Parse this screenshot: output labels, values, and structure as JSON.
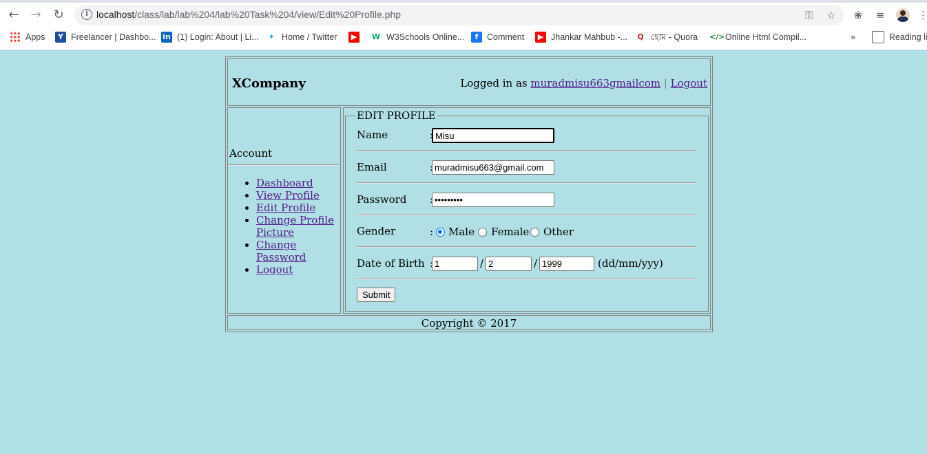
{
  "browser": {
    "url_host": "localhost",
    "url_path": "/class/lab/lab%204/lab%20Task%204/view/Edit%20Profile.php",
    "bookmarks": [
      {
        "label": "Apps",
        "icon": "apps-icon"
      },
      {
        "label": "Freelancer | Dashbo...",
        "icon": "freelancer-icon"
      },
      {
        "label": "(1) Login: About | Li...",
        "icon": "linkedin-icon"
      },
      {
        "label": "Home / Twitter",
        "icon": "twitter-icon"
      },
      {
        "label": "",
        "icon": "youtube-icon"
      },
      {
        "label": "W3Schools Online...",
        "icon": "w3schools-icon"
      },
      {
        "label": "Comment",
        "icon": "facebook-icon"
      },
      {
        "label": "Jhankar Mahbub -...",
        "icon": "youtube-icon"
      },
      {
        "label": "হোম - Quora",
        "icon": "quora-icon"
      },
      {
        "label": "Online Html Compil...",
        "icon": "code-icon"
      },
      {
        "label": "»",
        "icon": "more-bookmarks-icon"
      },
      {
        "label": "Reading lis",
        "icon": "reading-list-icon"
      }
    ]
  },
  "header": {
    "brand": "XCompany",
    "logged_in_prefix": "Logged in as",
    "user_link": "muradmisu663gmailcom",
    "separator": "|",
    "logout": "Logout"
  },
  "sidebar": {
    "title": "Account",
    "items": [
      "Dashboard",
      "View Profile",
      "Edit Profile",
      "Change Profile Picture",
      "Change Password",
      "Logout"
    ]
  },
  "form": {
    "legend": "EDIT PROFILE",
    "name_label": "Name",
    "name_value": "Misu",
    "email_label": "Email",
    "email_value": "muradmisu663@gmail.com",
    "password_label": "Password",
    "password_value": "•••••••••",
    "gender_label": "Gender",
    "gender_options": [
      "Male",
      "Female",
      "Other"
    ],
    "gender_selected": "Male",
    "dob_label": "Date of Birth",
    "dob_day": "1",
    "dob_month": "2",
    "dob_year": "1999",
    "dob_separator": "/",
    "dob_format": "(dd/mm/yyy)",
    "colon": ":",
    "submit": "Submit"
  },
  "footer": {
    "copyright": "Copyright © 2017"
  }
}
